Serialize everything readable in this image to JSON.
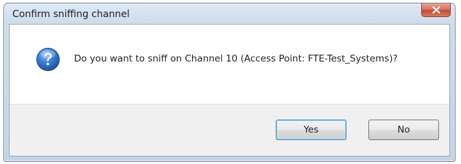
{
  "window": {
    "title": "Confirm sniffing channel",
    "close_icon": "close-x-icon"
  },
  "dialog": {
    "icon": "question-icon",
    "message": "Do you want to sniff on Channel 10 (Access Point: FTE-Test_Systems)?"
  },
  "buttons": {
    "yes_label": "Yes",
    "no_label": "No"
  },
  "colors": {
    "close_button": "#c64b34",
    "question_icon": "#2a62b8",
    "default_button_border": "#3c7fb1"
  }
}
